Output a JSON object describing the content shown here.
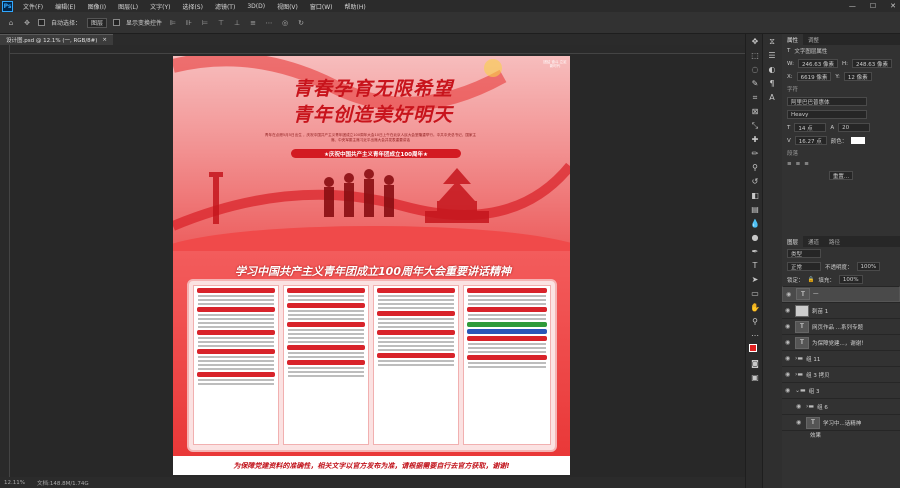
{
  "menu": {
    "app_logo": "Ps",
    "items": [
      "文件(F)",
      "编辑(E)",
      "图像(I)",
      "图层(L)",
      "文字(Y)",
      "选择(S)",
      "滤镜(T)",
      "3D(D)",
      "视图(V)",
      "窗口(W)",
      "帮助(H)"
    ]
  },
  "options": {
    "auto_select_label": "自动选择：",
    "auto_select_value": "图层",
    "show_transform_label": "显示变换控件"
  },
  "document": {
    "tab_title": "设计图.psd @ 12.1% (一, RGB/8#)",
    "close_glyph": "×",
    "zoom": "12.11%",
    "doc_info": "文档:148.8M/1.74G"
  },
  "poster": {
    "corner_tag": "团结 奋斗 立足新时代",
    "headline_1": "青春孕育无限希望",
    "headline_2": "青年创造美好明天",
    "subtext": "青年在点燃5月5日出生 ，庆祝中国共产主义青年团成立100周年大会10日上午在北京人民大会堂隆重举行。中共中央总书记、国家主席、中央军委主席习近平出席大会并发表重要讲话",
    "banner": "★庆祝中国共产主义青年团成立100周年★",
    "section_title": "学习中国共产主义青年团成立100周年大会重要讲话精神",
    "footer": "为保障党建资料的准确性，相关文字以官方发布为准，请根据需要自行去官方获取，谢谢!"
  },
  "properties_panel": {
    "tabs": [
      "属性",
      "调整"
    ],
    "layer_type": "文字图层属性",
    "w_label": "W:",
    "w_value": "246.63 像素",
    "h_label": "H:",
    "h_value": "248.63 像素",
    "x_label": "X:",
    "x_value": "6619 像素",
    "y_label": "Y:",
    "y_value": "12 像素",
    "section_char": "字符",
    "font": "阿里巴巴普惠体",
    "style": "Heavy",
    "size": "14 点",
    "leading": "20",
    "tracking": "16.27 点",
    "color_label": "颜色：",
    "section_para": "段落",
    "reset_label": "重置..."
  },
  "layers_panel": {
    "tabs": [
      "图层",
      "通道",
      "路径"
    ],
    "kind_label": "类型",
    "blend_mode": "正常",
    "opacity_label": "不透明度：",
    "opacity_value": "100%",
    "lock_label": "锁定：",
    "fill_label": "填充：",
    "fill_value": "100%",
    "layers": [
      {
        "name": "一",
        "type": "text",
        "selected": true
      },
      {
        "name": "刺苗 1",
        "type": "image",
        "selected": false
      },
      {
        "name": "网页作品 ...系列专题",
        "type": "text",
        "selected": false
      },
      {
        "name": "为保障党建...，谢谢！",
        "type": "text",
        "selected": false
      },
      {
        "name": "组 11",
        "type": "group",
        "selected": false
      },
      {
        "name": "组 3 拷贝",
        "type": "group",
        "selected": false
      },
      {
        "name": "组 3",
        "type": "group",
        "selected": false
      },
      {
        "name": "组 6",
        "type": "group",
        "selected": false
      },
      {
        "name": "学习中...话精神",
        "type": "text",
        "selected": false
      },
      {
        "name": "效果",
        "type": "effect",
        "selected": false
      }
    ]
  },
  "colors": {
    "accent": "#31a8ff",
    "poster_red": "#d8232a",
    "foreground": "#e02020"
  }
}
